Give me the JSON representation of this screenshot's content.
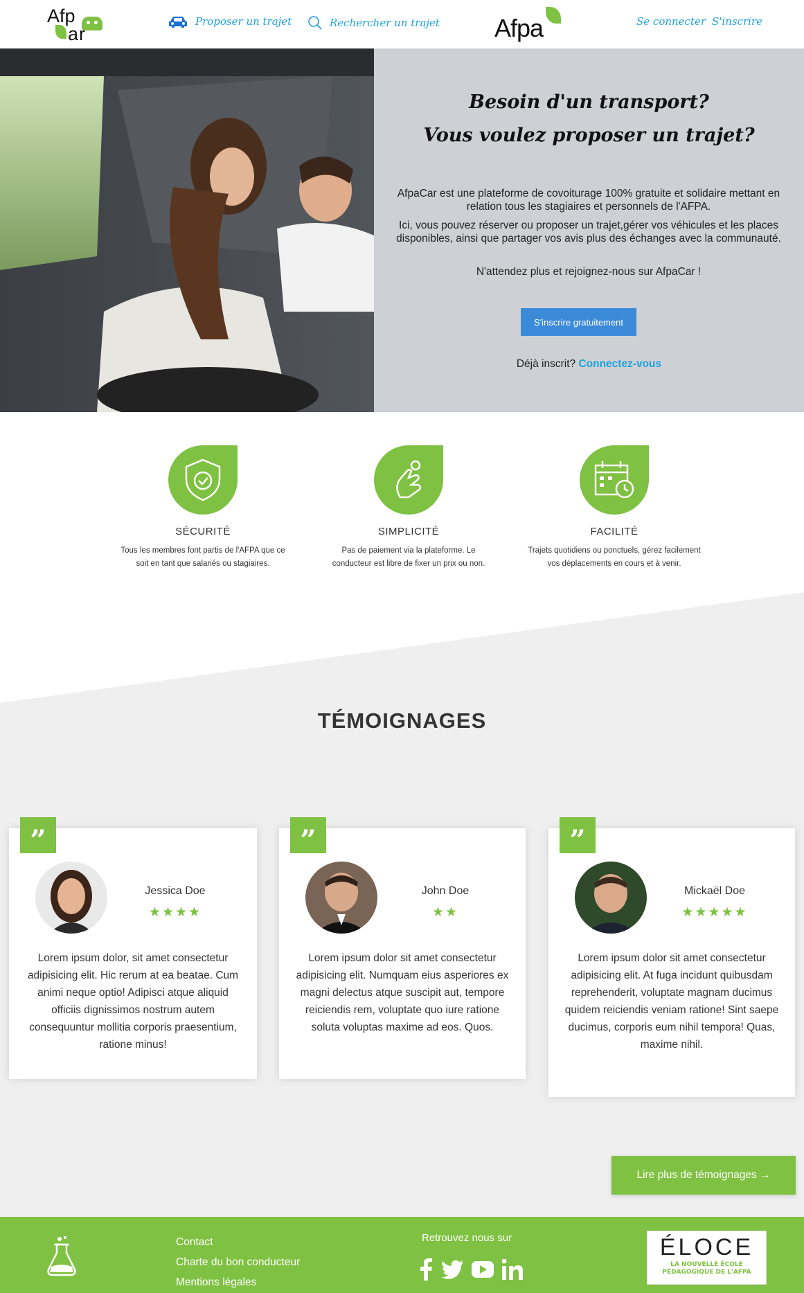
{
  "nav": {
    "logo_left": {
      "line1": "Afp",
      "line2": "ar"
    },
    "propose_label": "Proposer un trajet",
    "search_label": "Rechercher un trajet",
    "afpa_logo": "Afpa",
    "login_label": "Se connecter",
    "signup_label": "S'inscrire"
  },
  "hero": {
    "title_line1": "Besoin d'un transport?",
    "title_line2": "Vous voulez proposer un trajet?",
    "paragraph1": "AfpaCar est une plateforme de covoiturage 100% gratuite et solidaire mettant en relation tous les stagiaires et personnels de l'AFPA.",
    "paragraph2": "Ici, vous pouvez réserver ou proposer un trajet,gérer vos véhicules et les places disponibles, ainsi que partager vos avis plus des échanges avec la communauté.",
    "paragraph3": "N'attendez plus et rejoignez-nous sur AfpaCar !",
    "register_button": "S'inscrire gratuitement",
    "already_text": "Déjà inscrit?",
    "connect_link": "Connectez-vous"
  },
  "features": [
    {
      "title": "SÉCURITÉ",
      "desc": "Tous les membres font partis de l'AFPA que ce soit en tant que salariés ou stagiaires.",
      "icon": "shield-check-icon"
    },
    {
      "title": "SIMPLICITÉ",
      "desc": "Pas de paiement via la plateforme. Le conducteur est libre de fixer un prix ou non.",
      "icon": "hand-money-icon"
    },
    {
      "title": "FACILITÉ",
      "desc": "Trajets quotidiens ou ponctuels, gérez facilement vos déplacements en cours et à venir.",
      "icon": "calendar-clock-icon"
    }
  ],
  "testimonials": {
    "title": "TÉMOIGNAGES",
    "items": [
      {
        "name": "Jessica Doe",
        "stars": "★★★★",
        "rating": 4,
        "text": "Lorem ipsum dolor, sit amet consectetur adipisicing elit. Hic rerum at ea beatae. Cum animi neque optio! Adipisci atque aliquid officiis dignissimos nostrum autem consequuntur mollitia corporis praesentium, ratione minus!"
      },
      {
        "name": "John Doe",
        "stars": "★★",
        "rating": 2,
        "text": "Lorem ipsum dolor sit amet consectetur adipisicing elit. Numquam eius asperiores ex magni delectus atque suscipit aut, tempore reiciendis rem, voluptate quo iure ratione soluta voluptas maxime ad eos. Quos."
      },
      {
        "name": "Mickaël Doe",
        "stars": "★★★★★",
        "rating": 5,
        "text": "Lorem ipsum dolor sit amet consectetur adipisicing elit. At fuga incidunt quibusdam reprehenderit, voluptate magnam ducimus quidem reiciendis veniam ratione! Sint saepe ducimus, corporis eum nihil tempora! Quas, maxime nihil."
      }
    ],
    "quote_mark": "”",
    "more_button": "Lire plus de témoignages →"
  },
  "footer": {
    "links": [
      "Contact",
      "Charte du bon conducteur",
      "Mentions légales"
    ],
    "follow_label": "Retrouvez nous sur",
    "eloce_title": "ÉLOCE",
    "eloce_sub1": "LA NOUVELLE ÉCOLE",
    "eloce_sub2": "PÉDAGOGIQUE DE L'AFPA"
  },
  "colors": {
    "brand_green": "#7fc142",
    "link_blue": "#1da1dc",
    "button_blue": "#3b8ad7"
  }
}
